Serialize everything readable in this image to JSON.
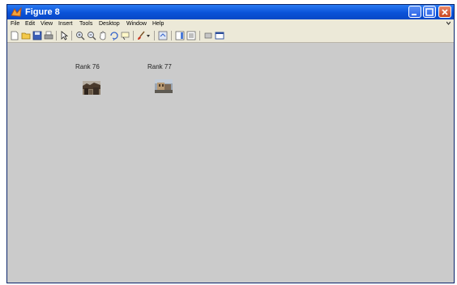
{
  "window": {
    "title": "Figure 8",
    "title_color": "#0a52d8"
  },
  "menu": {
    "items": [
      "File",
      "Edit",
      "View",
      "Insert",
      "Tools",
      "Desktop",
      "Window",
      "Help"
    ]
  },
  "toolbar": {
    "icons": [
      "new-file-icon",
      "open-folder-icon",
      "save-icon",
      "print-icon",
      "pointer-arrow-icon",
      "zoom-in-icon",
      "zoom-out-icon",
      "pan-hand-icon",
      "rotate-3d-icon",
      "data-cursor-icon",
      "brush-icon",
      "dropdown-icon",
      "link-icon",
      "colorbar-icon",
      "legend-icon",
      "hide-plot-tools-icon",
      "show-plot-tools-icon"
    ]
  },
  "panels": [
    {
      "label": "Rank 76"
    },
    {
      "label": "Rank 77"
    }
  ],
  "colors": {
    "canvas_bg": "#cbcbcb",
    "chrome_bg": "#ece9d8"
  }
}
